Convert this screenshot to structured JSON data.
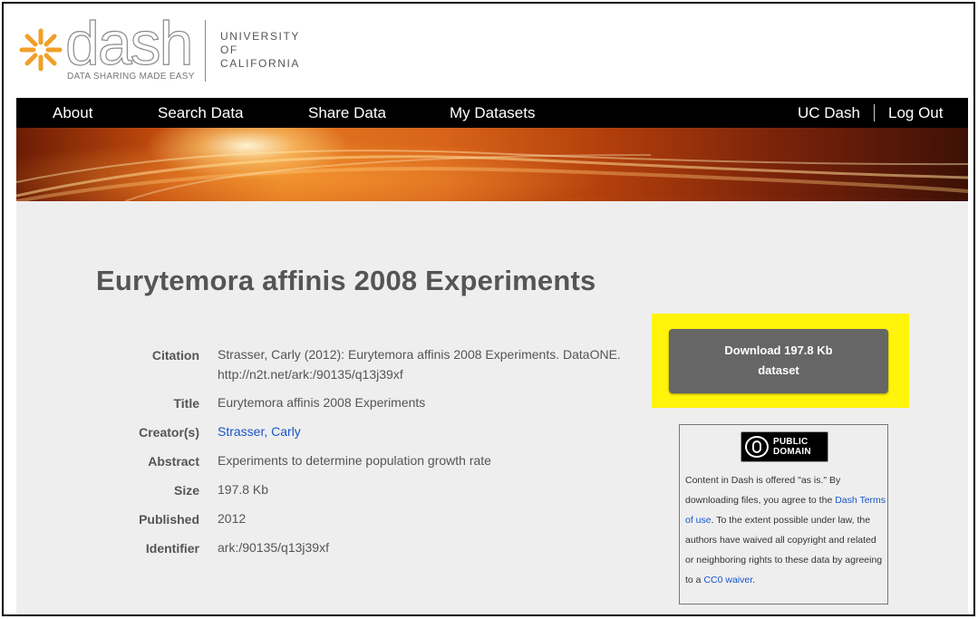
{
  "brand": {
    "name": "dash",
    "tagline": "DATA SHARING MADE EASY",
    "university_lines": [
      "UNIVERSITY",
      "OF",
      "CALIFORNIA"
    ],
    "accent_color": "#f0a02a"
  },
  "nav": {
    "items": [
      "About",
      "Search Data",
      "Share Data",
      "My Datasets"
    ],
    "right_items": [
      "UC Dash",
      "Log Out"
    ]
  },
  "dataset": {
    "title": "Eurytemora affinis 2008 Experiments",
    "fields": {
      "citation_label": "Citation",
      "citation_line1": "Strasser, Carly (2012): Eurytemora affinis 2008 Experiments. DataONE.",
      "citation_line2": "http://n2t.net/ark:/90135/q13j39xf",
      "title_label": "Title",
      "title_value": "Eurytemora affinis 2008 Experiments",
      "creators_label": "Creator(s)",
      "creators_value": "Strasser, Carly",
      "abstract_label": "Abstract",
      "abstract_value": "Experiments to determine population growth rate",
      "size_label": "Size",
      "size_value": "197.8 Kb",
      "published_label": "Published",
      "published_value": "2012",
      "identifier_label": "Identifier",
      "identifier_value": "ark:/90135/q13j39xf"
    }
  },
  "download": {
    "line1": "Download 197.8 Kb",
    "line2": "dataset",
    "highlight_color": "#fff40a"
  },
  "license": {
    "badge_line1": "PUBLIC",
    "badge_line2": "DOMAIN",
    "text_1": "Content in Dash is offered \"as is.\" By downloading files, you agree to the ",
    "link_terms": "Dash Terms of use",
    "text_2": ". To the extent possible under law, the authors have waived all copyright and related or neighboring rights to these data by agreeing to a ",
    "link_cc0": "CC0 waiver",
    "text_3": "."
  }
}
